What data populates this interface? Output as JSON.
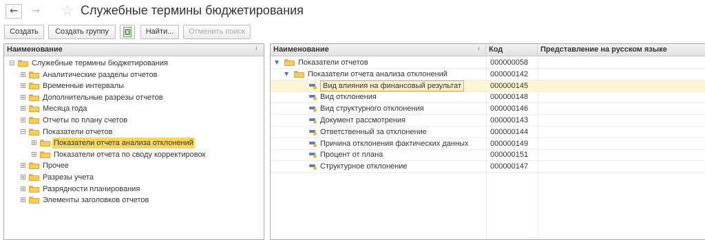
{
  "window": {
    "title": "Служебные термины бюджетирования"
  },
  "nav": {
    "back": "←",
    "forward": "→",
    "favorite": "☆"
  },
  "toolbar": {
    "create": "Создать",
    "create_group": "Создать группу",
    "find": "Найти...",
    "cancel_search": "Отменить поиск"
  },
  "left": {
    "header": "Наименование",
    "sort_mark": "↓",
    "rows": [
      {
        "label": "Служебные термины бюджетирования",
        "level": 0,
        "expander": "−"
      },
      {
        "label": "Аналитические разделы отчетов",
        "level": 1,
        "expander": "+"
      },
      {
        "label": "Временные интервалы",
        "level": 1,
        "expander": "+"
      },
      {
        "label": "Дополнительные разрезы отчетов",
        "level": 1,
        "expander": "+"
      },
      {
        "label": "Месяца года",
        "level": 1,
        "expander": "+"
      },
      {
        "label": "Отчеты по плану счетов",
        "level": 1,
        "expander": "+"
      },
      {
        "label": "Показатели отчетов",
        "level": 1,
        "expander": "−"
      },
      {
        "label": "Показатели отчета анализа отклонений",
        "level": 2,
        "expander": "+",
        "selected": true
      },
      {
        "label": "Показатели отчета по своду корректировок",
        "level": 2,
        "expander": "+"
      },
      {
        "label": "Прочее",
        "level": 1,
        "expander": "+"
      },
      {
        "label": "Разрезы учета",
        "level": 1,
        "expander": "+"
      },
      {
        "label": "Разрядности планирования",
        "level": 1,
        "expander": "+"
      },
      {
        "label": "Элементы заголовков отчетов",
        "level": 1,
        "expander": "+"
      }
    ]
  },
  "right": {
    "headers": {
      "name": "Наименование",
      "code": "Код",
      "russian": "Представление на русском языке"
    },
    "sort_mark": "↓",
    "rows": [
      {
        "label": "Показатели отчетов",
        "code": "000000058",
        "type": "group",
        "level": 0
      },
      {
        "label": "Показатели отчета анализа отклонений",
        "code": "000000142",
        "type": "group",
        "level": 1
      },
      {
        "label": "Вид влияния на финансовый результат",
        "code": "000000145",
        "type": "item",
        "level": 2,
        "selected": true
      },
      {
        "label": "Вид отклонения",
        "code": "000000148",
        "type": "item",
        "level": 2
      },
      {
        "label": "Вид структурного отклонения",
        "code": "000000146",
        "type": "item",
        "level": 2
      },
      {
        "label": "Документ рассмотрения",
        "code": "000000143",
        "type": "item",
        "level": 2
      },
      {
        "label": "Ответственный за отклонение",
        "code": "000000144",
        "type": "item",
        "level": 2
      },
      {
        "label": "Причина отклонения фактических данных",
        "code": "000000149",
        "type": "item",
        "level": 2
      },
      {
        "label": "Процент от плана",
        "code": "000000151",
        "type": "item",
        "level": 2
      },
      {
        "label": "Структурное отклонение",
        "code": "000000147",
        "type": "item",
        "level": 2
      }
    ]
  }
}
